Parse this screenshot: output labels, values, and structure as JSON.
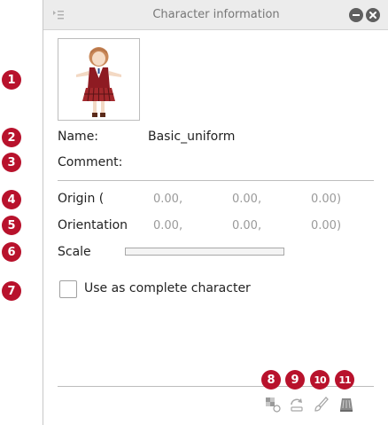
{
  "window": {
    "title": "Character information"
  },
  "info": {
    "name_label": "Name:",
    "name_value": "Basic_uniform",
    "comment_label": "Comment:",
    "origin_label": "Origin (",
    "origin_values": [
      "0.00,",
      "0.00,",
      "0.00)"
    ],
    "orientation_label": "Orientation",
    "orientation_values": [
      "0.00,",
      "0.00,",
      "0.00)"
    ],
    "scale_label": "Scale",
    "complete_character_label": "Use as complete character"
  },
  "callouts": [
    "1",
    "2",
    "3",
    "4",
    "5",
    "6",
    "7",
    "8",
    "9",
    "10",
    "11"
  ],
  "toolbar_icons": [
    "texture-icon",
    "reset-pose-icon",
    "brush-icon",
    "model-icon"
  ],
  "colors": {
    "callout": "#b8122c",
    "inactive": "#9a9a9a"
  }
}
